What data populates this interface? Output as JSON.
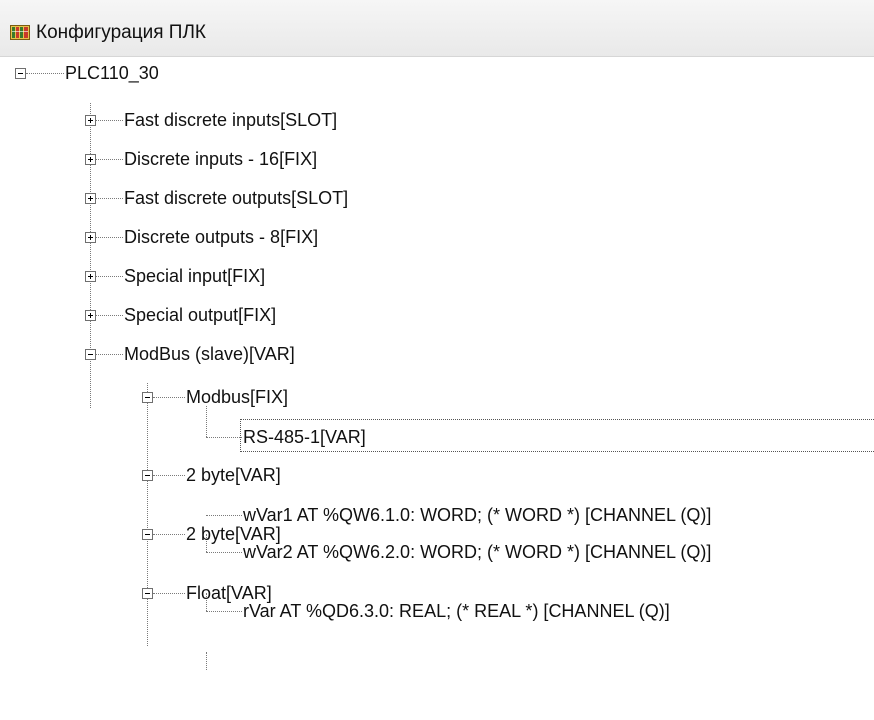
{
  "window": {
    "title": "Конфигурация ПЛК",
    "icon": "plc-config-icon"
  },
  "tree": {
    "root": "PLC110_30",
    "items": [
      {
        "label": "Fast discrete inputs[SLOT]",
        "state": "collapsed"
      },
      {
        "label": "Discrete inputs - 16[FIX]",
        "state": "collapsed"
      },
      {
        "label": "Fast discrete outputs[SLOT]",
        "state": "collapsed"
      },
      {
        "label": "Discrete outputs - 8[FIX]",
        "state": "collapsed"
      },
      {
        "label": "Special input[FIX]",
        "state": "collapsed"
      },
      {
        "label": "Special output[FIX]",
        "state": "collapsed"
      },
      {
        "label": "ModBus (slave)[VAR]",
        "state": "expanded"
      }
    ],
    "modbus_children": [
      {
        "label": "Modbus[FIX]",
        "state": "expanded",
        "child": "RS-485-1[VAR]"
      },
      {
        "label": "2 byte[VAR]",
        "state": "expanded",
        "child": "wVar1 AT %QW6.1.0: WORD; (* WORD *) [CHANNEL (Q)]"
      },
      {
        "label": "2 byte[VAR]",
        "state": "expanded",
        "child": "wVar2 AT %QW6.2.0: WORD; (* WORD *) [CHANNEL (Q)]"
      },
      {
        "label": "Float[VAR]",
        "state": "expanded",
        "child": "rVar AT %QD6.3.0: REAL; (* REAL *) [CHANNEL (Q)]"
      }
    ],
    "selected": "RS-485-1[VAR]"
  }
}
